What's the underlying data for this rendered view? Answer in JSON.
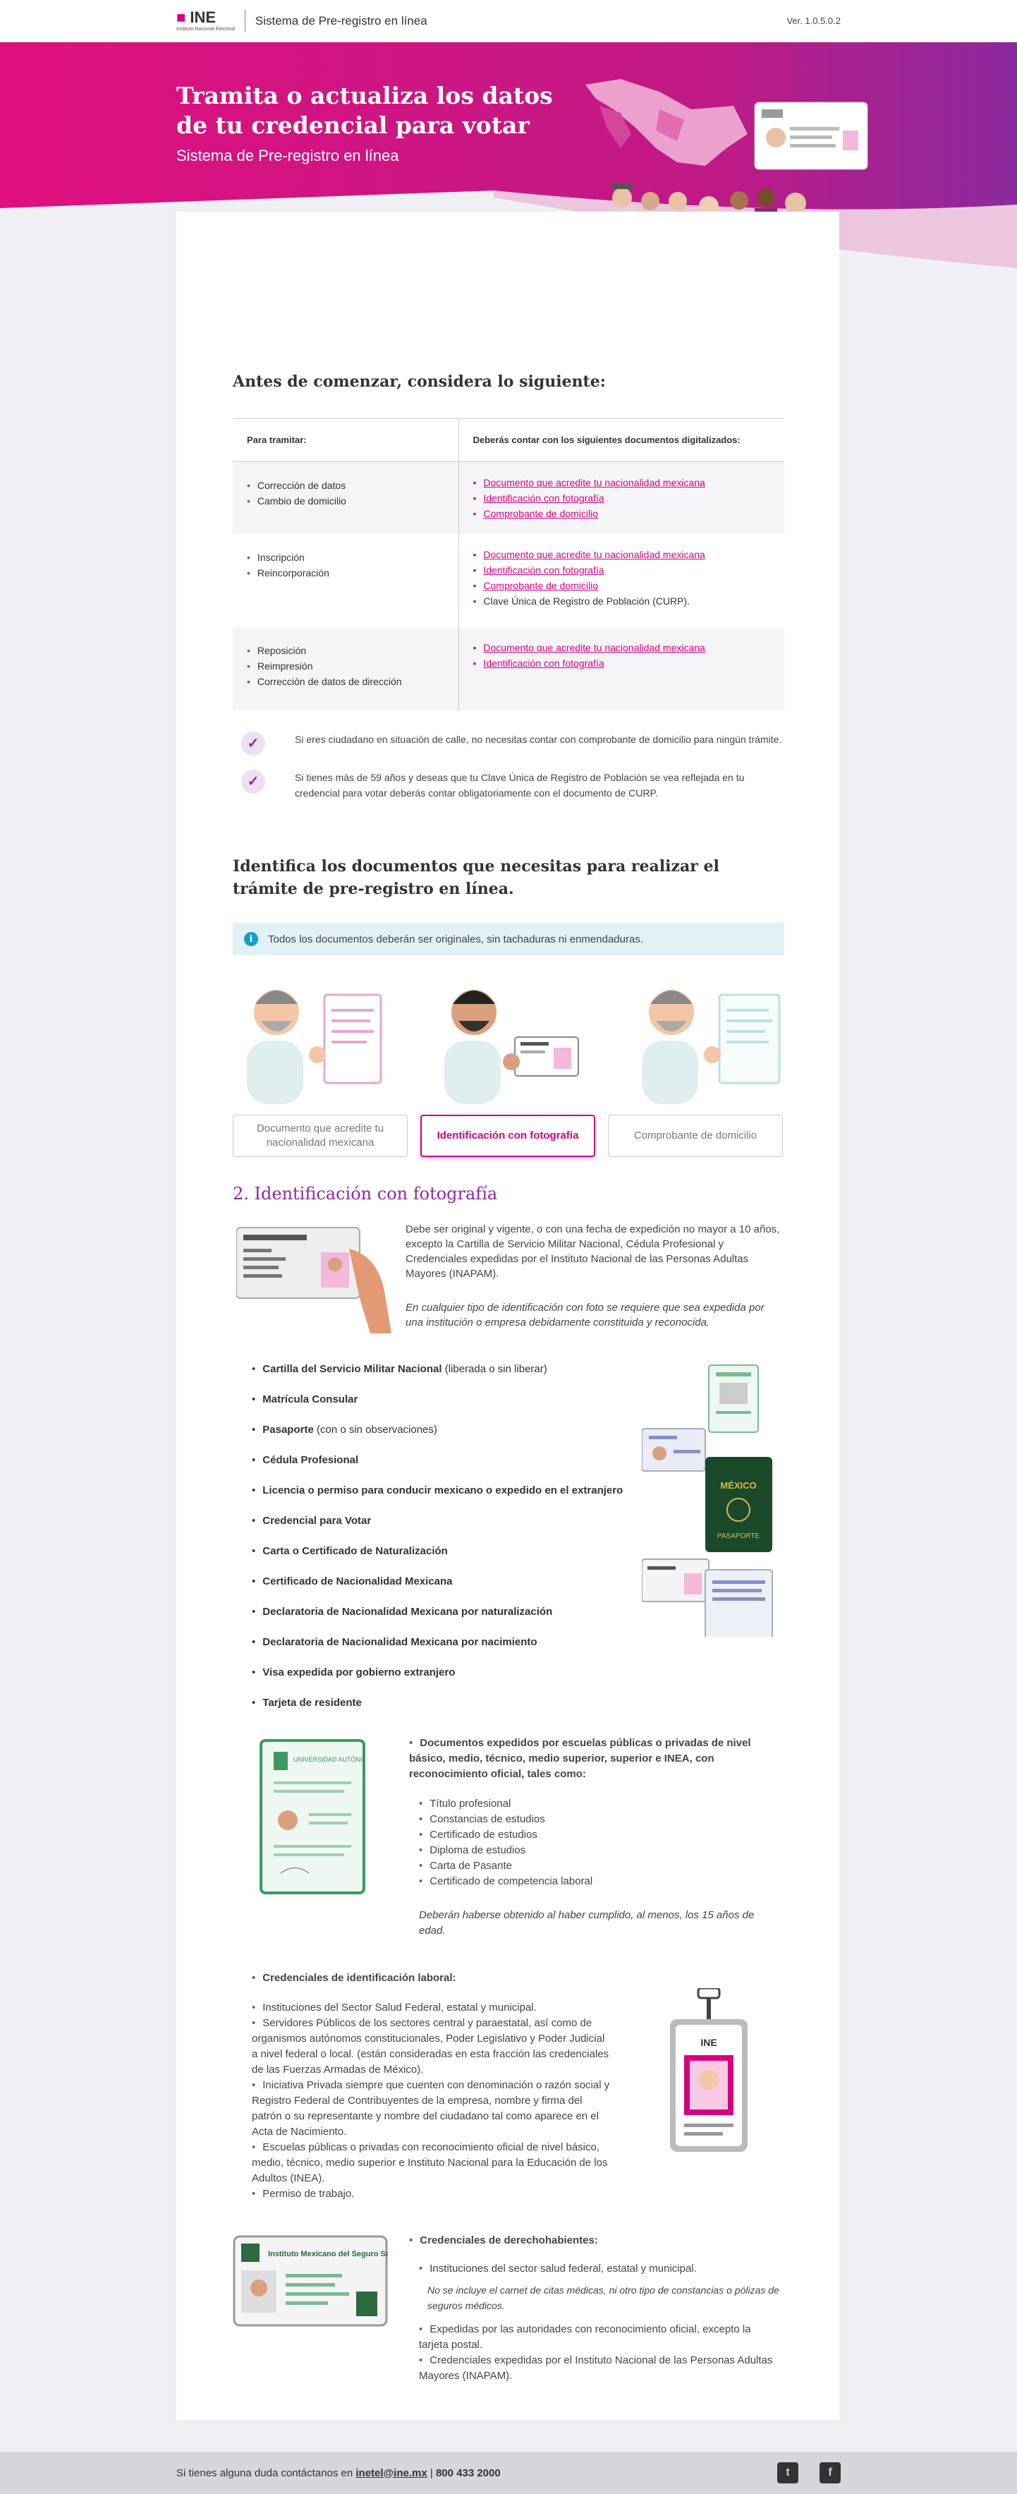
{
  "header": {
    "logo_text": "INE",
    "logo_subtext": "Instituto Nacional Electoral",
    "app_title": "Sistema de Pre-registro en línea",
    "version": "Ver. 1.0.5.0.2"
  },
  "hero": {
    "title": "Tramita o actualiza los datos de tu credencial para votar",
    "subtitle": "Sistema de Pre-registro en línea"
  },
  "requirements": {
    "heading": "Antes de comenzar, considera lo siguiente:",
    "col1": "Para tramitar:",
    "col2": "Deberás contar con los siguientes documentos digitalizados:",
    "rows": [
      {
        "tramites": [
          "Corrección de datos",
          "Cambio de domicilio"
        ],
        "docs": [
          {
            "text": "Documento que acredite tu nacionalidad mexicana",
            "link": true
          },
          {
            "text": "Identificación con fotografía",
            "link": true
          },
          {
            "text": "Comprobante de domicilio",
            "link": true
          }
        ]
      },
      {
        "tramites": [
          "Inscripción",
          "Reincorporación"
        ],
        "docs": [
          {
            "text": "Documento que acredite tu nacionalidad mexicana",
            "link": true
          },
          {
            "text": "Identificación con fotografía",
            "link": true
          },
          {
            "text": "Comprobante de domicilio",
            "link": true
          },
          {
            "text": "Clave Única de Registro de Población (CURP).",
            "link": false
          }
        ]
      },
      {
        "tramites": [
          "Reposición",
          "Reimpresión",
          "Corrección de datos de dirección"
        ],
        "docs": [
          {
            "text": "Documento que acredite tu nacionalidad mexicana",
            "link": true
          },
          {
            "text": "Identificación con fotografía",
            "link": true
          }
        ]
      }
    ],
    "notes": [
      "Si eres ciudadano en situación de calle, no necesitas contar con comprobante de domicilio para ningún trámite.",
      "Si tienes más de 59 años y deseas que tu Clave Única de Registro de Población se vea reflejada en tu credencial para votar deberás contar obligatoriamente con el documento de CURP."
    ]
  },
  "identify": {
    "heading": "Identifica los documentos que necesitas para realizar el trámite de pre-registro en línea.",
    "info": "Todos los documentos deberán ser originales, sin tachaduras ni enmendaduras.",
    "tabs": [
      {
        "label": "Documento que acredite tu nacionalidad mexicana",
        "active": false
      },
      {
        "label": "Identificación con fotografía",
        "active": true
      },
      {
        "label": "Comprobante de domicilio",
        "active": false
      }
    ]
  },
  "section2": {
    "title": "2. Identificación con fotografía",
    "intro": "Debe ser original y vigente, o con una fecha de expedición no mayor a 10 años, excepto la Cartilla de Servicio Militar Nacional, Cédula Profesional y Credenciales expedidas por el Instituto Nacional de las Personas Adultas Mayores (INAPAM).",
    "intro_note": "En cualquier tipo de identificación con foto se requiere que sea expedida por una institución o empresa debidamente constituida y reconocida.",
    "ids": [
      {
        "bold": "Cartilla del Servicio Militar Nacional",
        "rest": " (liberada o sin liberar)"
      },
      {
        "bold": "Matrícula Consular",
        "rest": ""
      },
      {
        "bold": "Pasaporte",
        "rest": " (con o sin observaciones)"
      },
      {
        "bold": "Cédula Profesional",
        "rest": ""
      },
      {
        "bold": "Licencia o permiso para conducir mexicano o expedido en el extranjero",
        "rest": ""
      },
      {
        "bold": "Credencial para Votar",
        "rest": ""
      },
      {
        "bold": "Carta o Certificado de Naturalización",
        "rest": ""
      },
      {
        "bold": "Certificado de Nacionalidad Mexicana",
        "rest": ""
      },
      {
        "bold": "Declaratoria de Nacionalidad Mexicana por naturalización",
        "rest": ""
      },
      {
        "bold": "Declaratoria de Nacionalidad Mexicana por nacimiento",
        "rest": ""
      },
      {
        "bold": "Visa expedida por gobierno extranjero",
        "rest": ""
      },
      {
        "bold": "Tarjeta de residente",
        "rest": ""
      }
    ],
    "passport_label_top": "MÉXICO",
    "passport_label_bottom": "PASAPORTE",
    "school": {
      "card_title": "UNIVERSIDAD AUTÓNOMA",
      "heading": "Documentos expedidos por escuelas públicas o privadas de nivel básico, medio, técnico, medio superior, superior e INEA, con reconocimiento oficial, tales como:",
      "items": [
        "Título profesional",
        "Constancias de estudios",
        "Certificado de estudios",
        "Diploma de estudios",
        "Carta de Pasante",
        "Certificado de competencia laboral"
      ],
      "note": "Deberán haberse obtenido al haber cumplido, al menos, los 15 años de edad."
    },
    "labor": {
      "heading": "Credenciales de identificación laboral:",
      "items": [
        "Instituciones del Sector Salud Federal, estatal y municipal.",
        "Servidores Públicos de los sectores central y paraestatal, así como de organismos autónomos constitucionales, Poder Legislativo y Poder Judicial a nivel federal o local. (están consideradas en esta fracción las credenciales de las Fuerzas Armadas de México).",
        "Iniciativa Privada siempre que cuenten con denominación o razón social y Registro Federal de Contribuyentes de la empresa, nombre y firma del patrón o su representante y nombre del ciudadano tal como aparece en el Acta de Nacimiento.",
        "Escuelas públicas o privadas con reconocimiento oficial de nivel básico, medio, técnico, medio superior e Instituto Nacional para la Educación de los Adultos (INEA).",
        "Permiso de trabajo."
      ],
      "badge_logo": "INE"
    },
    "health": {
      "card_title": "Instituto Mexicano del Seguro Social",
      "heading": "Credenciales de derechohabientes:",
      "item1": "Instituciones del sector salud federal, estatal y municipal.",
      "note": "No se incluye el carnet de citas médicas, ni otro tipo de constancias o pólizas de seguros médicos.",
      "items2": [
        "Expedidas por las autoridades con reconocimiento oficial, excepto la tarjeta postal.",
        "Credenciales expedidas por el Instituto Nacional de las Personas Adultas Mayores (INAPAM)."
      ]
    }
  },
  "footer": {
    "text": "Si tienes alguna duda contáctanos en",
    "email": "inetel@ine.mx",
    "phone": "800 433 2000",
    "twitter_icon": "twitter-icon",
    "facebook_icon": "facebook-icon"
  },
  "colors": {
    "brand_pink": "#d5007f",
    "purple": "#8a2a9e",
    "info_bg": "#e1f1f6"
  }
}
